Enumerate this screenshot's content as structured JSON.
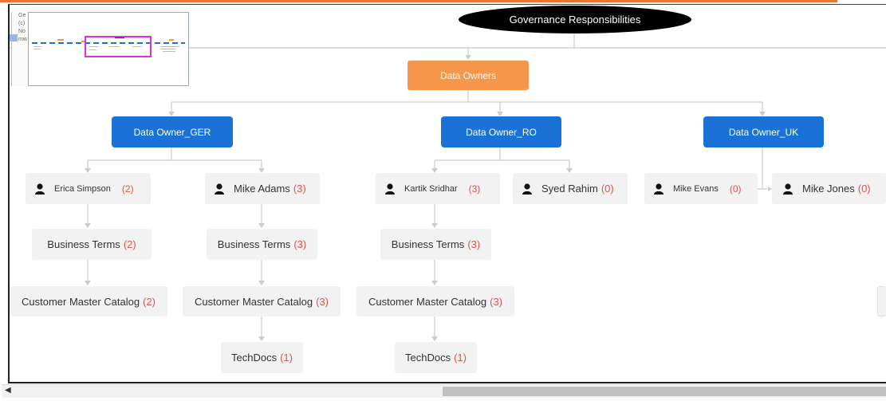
{
  "diagram": {
    "title": "Governance Responsibilities",
    "root": "Data Owners",
    "groups": [
      {
        "label": "Data Owner_GER",
        "people": [
          {
            "name": "Erica Simpson",
            "count": "(2)"
          },
          {
            "name": "Mike Adams",
            "count": "(3)"
          }
        ]
      },
      {
        "label": "Data Owner_RO",
        "people": [
          {
            "name": "Kartik Sridhar",
            "count": "(3)"
          },
          {
            "name": "Syed Rahim",
            "count": "(0)"
          }
        ]
      },
      {
        "label": "Data Owner_UK",
        "people": [
          {
            "name": "Mike Evans",
            "count": "(0)"
          },
          {
            "name": "Mike Jones",
            "count": "(0)"
          }
        ]
      }
    ],
    "assets": {
      "erica_terms": {
        "label": "Business Terms",
        "count": "(2)"
      },
      "erica_catalog": {
        "label": "Customer Master Catalog",
        "count": "(2)"
      },
      "mike_terms": {
        "label": "Business Terms",
        "count": "(3)"
      },
      "mike_catalog": {
        "label": "Customer Master Catalog",
        "count": "(3)"
      },
      "mike_techdocs": {
        "label": "TechDocs",
        "count": "(1)"
      },
      "kartik_terms": {
        "label": "Business Terms",
        "count": "(3)"
      },
      "kartik_catalog": {
        "label": "Customer Master Catalog",
        "count": "(3)"
      },
      "kartik_techdocs": {
        "label": "TechDocs",
        "count": "(1)"
      }
    }
  },
  "minimap": {
    "legend": [
      "Ge",
      "(c)",
      "No",
      "mw"
    ]
  },
  "colors": {
    "title_node": "#000000",
    "root_node": "#f5964a",
    "owner_node": "#1a72d6",
    "count_text": "#d9534f",
    "viewport_box": "#e02de0"
  }
}
